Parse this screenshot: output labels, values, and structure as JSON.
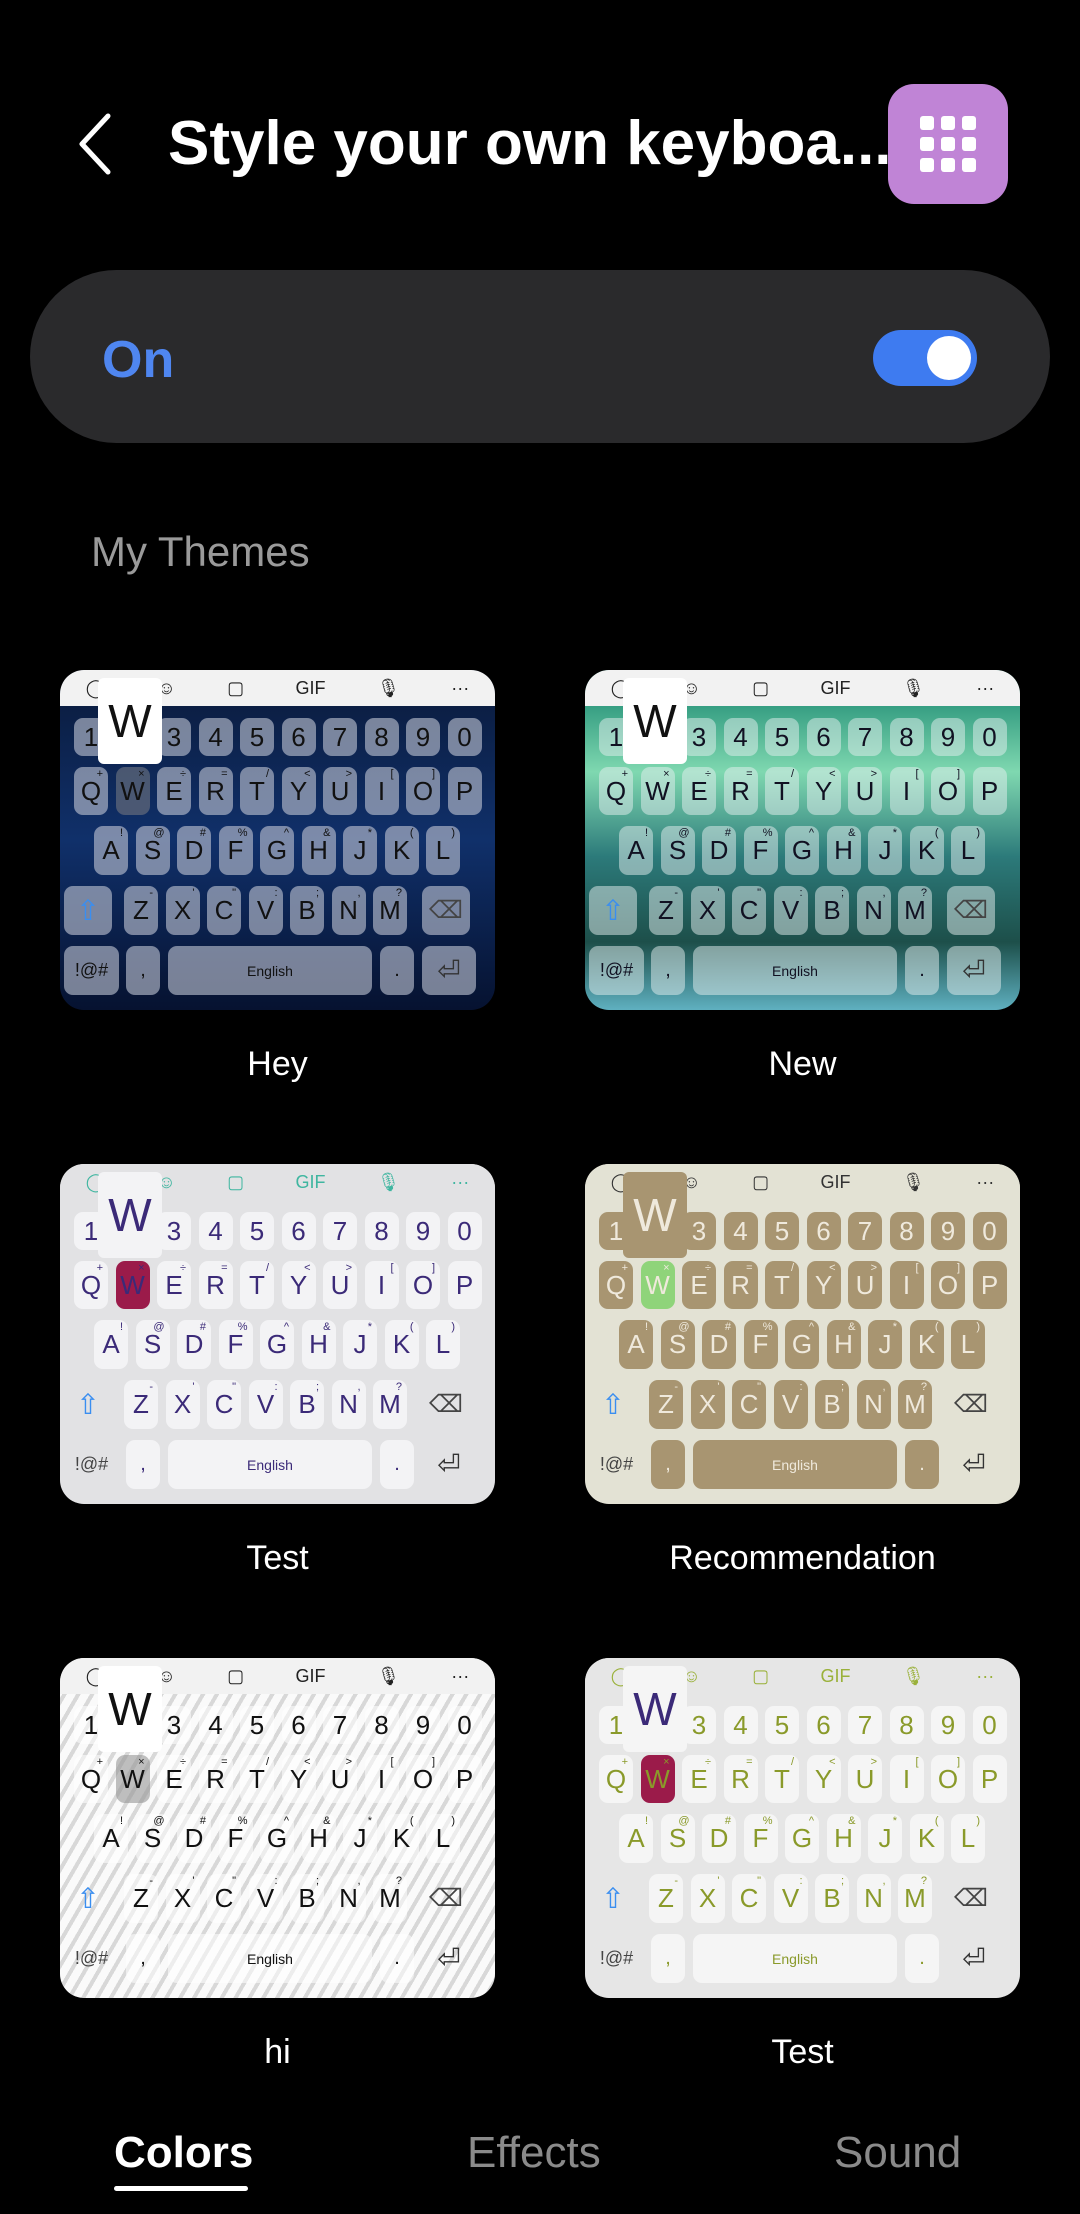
{
  "header": {
    "title": "Style your own keyboa...",
    "back_icon": "chevron-left-icon",
    "action_icon": "keypad-grid-icon",
    "action_color": "#c084d6"
  },
  "master_toggle": {
    "label": "On",
    "state": true,
    "accent": "#4f86f0"
  },
  "section_title": "My Themes",
  "keyboard": {
    "toolbar_icons": [
      "search-icon",
      "emoji-icon",
      "sticker-icon",
      "gif-icon",
      "mic-icon",
      "more-icon"
    ],
    "toolbar_glyphs": [
      "◯",
      "☺",
      "▢",
      "GIF",
      "🎙",
      "···"
    ],
    "numbers": [
      "1",
      "2",
      "3",
      "4",
      "5",
      "6",
      "7",
      "8",
      "9",
      "0"
    ],
    "row1": [
      "Q",
      "W",
      "E",
      "R",
      "T",
      "Y",
      "U",
      "I",
      "O",
      "P"
    ],
    "row1_hints": [
      "+",
      "×",
      "÷",
      "=",
      "/",
      "<",
      ">",
      "[",
      "]",
      ""
    ],
    "row2": [
      "A",
      "S",
      "D",
      "F",
      "G",
      "H",
      "J",
      "K",
      "L"
    ],
    "row2_hints": [
      "!",
      "@",
      "#",
      "%",
      "^",
      "&",
      "*",
      "(",
      ")"
    ],
    "row3": [
      "Z",
      "X",
      "C",
      "V",
      "B",
      "N",
      "M"
    ],
    "row3_hints": [
      "-",
      "'",
      "\"",
      ":",
      ";",
      ",",
      "?"
    ],
    "symbols": "!@#",
    "comma": ",",
    "space": "English",
    "period": ".",
    "popup": "W"
  },
  "themes": [
    {
      "name": "Hey",
      "bg": "linear-gradient(180deg,#0a1a3a,#10306a 50%,#061230)",
      "tb": "#f2f2f2",
      "tbfg": "#222",
      "key": "rgba(190,195,210,0.62)",
      "fg": "#111",
      "hl": "rgba(90,100,120,0.8)",
      "popbg": "#fff",
      "popfg": "#111",
      "fnkey": true
    },
    {
      "name": "New",
      "bg": "linear-gradient(180deg,#0f7f6a,#7fd8b0 30%,#2c7a7a 55%,#1d4f4a 80%,#5fb0c0)",
      "tb": "#f2f2f2",
      "tbfg": "#222",
      "key": "rgba(230,240,240,0.5)",
      "fg": "#112",
      "hl": "rgba(230,240,240,0.5)",
      "popbg": "#fff",
      "popfg": "#111",
      "fnkey": true
    },
    {
      "name": "Test",
      "bg": "#e2e2e4",
      "tb": "#e2e2e4",
      "tbfg": "#3fb6a0",
      "key": "#f3f3f5",
      "fg": "#3b2a78",
      "hl": "#9b1b4a",
      "popbg": "#f3f3f5",
      "popfg": "#3b2a78",
      "fnkey": false
    },
    {
      "name": "Recommendation",
      "bg": "#e3e2d4",
      "tb": "#e3e2d4",
      "tbfg": "#333",
      "key": "#a89571",
      "fg": "#efe9dc",
      "hl": "#8fd47a",
      "popbg": "#a89571",
      "popfg": "#efe9dc",
      "fnkey": false
    },
    {
      "name": "hi",
      "bg": "repeating-linear-gradient(120deg,#fafafa 0 8px,#d8d8d8 8px 12px)",
      "tb": "#f2f2f2",
      "tbfg": "#222",
      "key": "rgba(255,255,255,0.55)",
      "fg": "#111",
      "hl": "rgba(150,150,150,0.6)",
      "popbg": "#fff",
      "popfg": "#111",
      "fnkey": false
    },
    {
      "name": "Test",
      "bg": "#e6e6e6",
      "tb": "#e6e6e6",
      "tbfg": "#9ab13a",
      "key": "#f5f5f5",
      "fg": "#8a9a2a",
      "hl": "#9b1b4a",
      "popbg": "#f5f5f5",
      "popfg": "#3b2a78",
      "fnkey": false
    }
  ],
  "tabs": [
    {
      "label": "Colors",
      "active": true
    },
    {
      "label": "Effects",
      "active": false
    },
    {
      "label": "Sound",
      "active": false
    }
  ]
}
